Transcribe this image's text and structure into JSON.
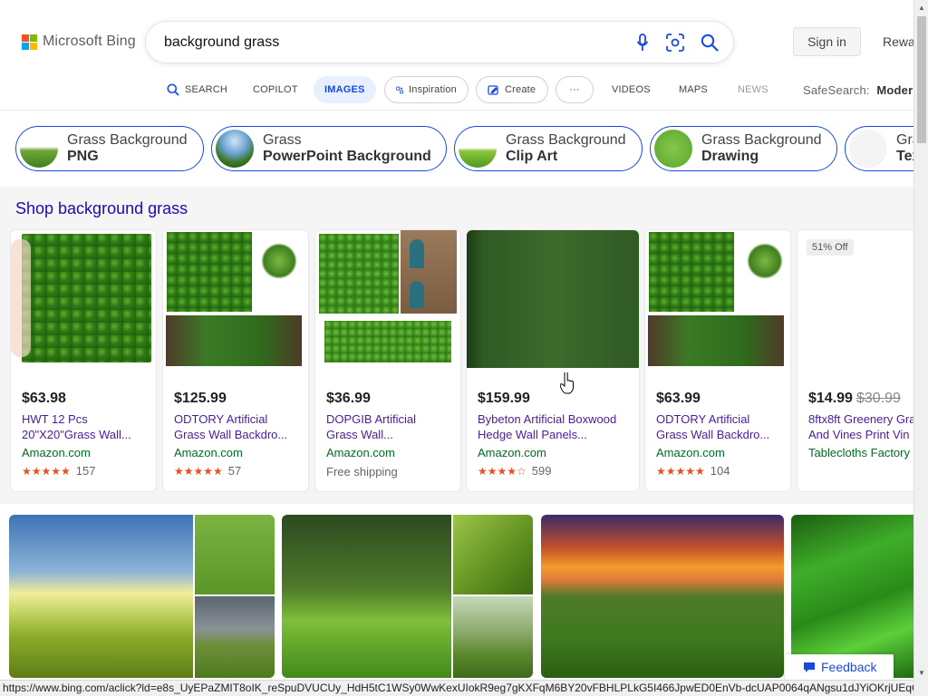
{
  "header": {
    "brand": "Microsoft Bing",
    "search_value": "background grass",
    "signin_label": "Sign in",
    "rewards_label": "Rewa"
  },
  "nav": {
    "search": "SEARCH",
    "copilot": "COPILOT",
    "images": "IMAGES",
    "inspiration": "Inspiration",
    "create": "Create",
    "more": "···",
    "videos": "VIDEOS",
    "maps": "MAPS",
    "news": "NEWS",
    "safesearch_label": "SafeSearch:",
    "safesearch_value": "Moder"
  },
  "related": [
    {
      "line1": "Grass Background",
      "line2": "PNG"
    },
    {
      "line1": "Grass",
      "line2": "PowerPoint Background"
    },
    {
      "line1": "Grass Background",
      "line2": "Clip Art"
    },
    {
      "line1": "Grass Background",
      "line2": "Drawing"
    },
    {
      "line1": "Gra",
      "line2": "Tex"
    }
  ],
  "shop": {
    "title": "Shop background grass",
    "products": [
      {
        "price": "$63.98",
        "title": "HWT 12 Pcs\n20\"X20\"Grass Wall...",
        "store": "Amazon.com",
        "stars": "★★★★★",
        "reviews": "157"
      },
      {
        "price": "$125.99",
        "title": "ODTORY Artificial\nGrass Wall Backdro...",
        "store": "Amazon.com",
        "stars": "★★★★★",
        "reviews": "57"
      },
      {
        "price": "$36.99",
        "title": "DOPGIB Artificial\nGrass Wall...",
        "store": "Amazon.com",
        "shipping": "Free shipping"
      },
      {
        "price": "$159.99",
        "title": "Bybeton Artificial Boxwood\nHedge Wall Panels...",
        "store": "Amazon.com",
        "stars": "★★★★☆",
        "reviews": "599"
      },
      {
        "price": "$63.99",
        "title": "ODTORY Artificial\nGrass Wall Backdro...",
        "store": "Amazon.com",
        "stars": "★★★★★",
        "reviews": "104"
      },
      {
        "badge": "51% Off",
        "price": "$14.99",
        "old_price": "$30.99",
        "title": "8ftx8ft Greenery Gra\nAnd Vines Print Vin",
        "store": "Tablecloths Factory"
      }
    ]
  },
  "status_url": "https://www.bing.com/aclick?ld=e8s_UyEPaZMIT8oIK_reSpuDVUCUy_HdH5tC1WSy0WwKexUIokR9eg7gKXFqM6BY20vFBHLPLkG5I466JpwED0EnVb-dcUAP0064qANgsu1dJYiOKrjUEqG6Hbv...",
  "feedback_label": "Feedback",
  "colors": {
    "accent": "#174ae4",
    "link_visited": "#4a1c9b",
    "star": "#e7511e",
    "store_green": "#006d21"
  }
}
